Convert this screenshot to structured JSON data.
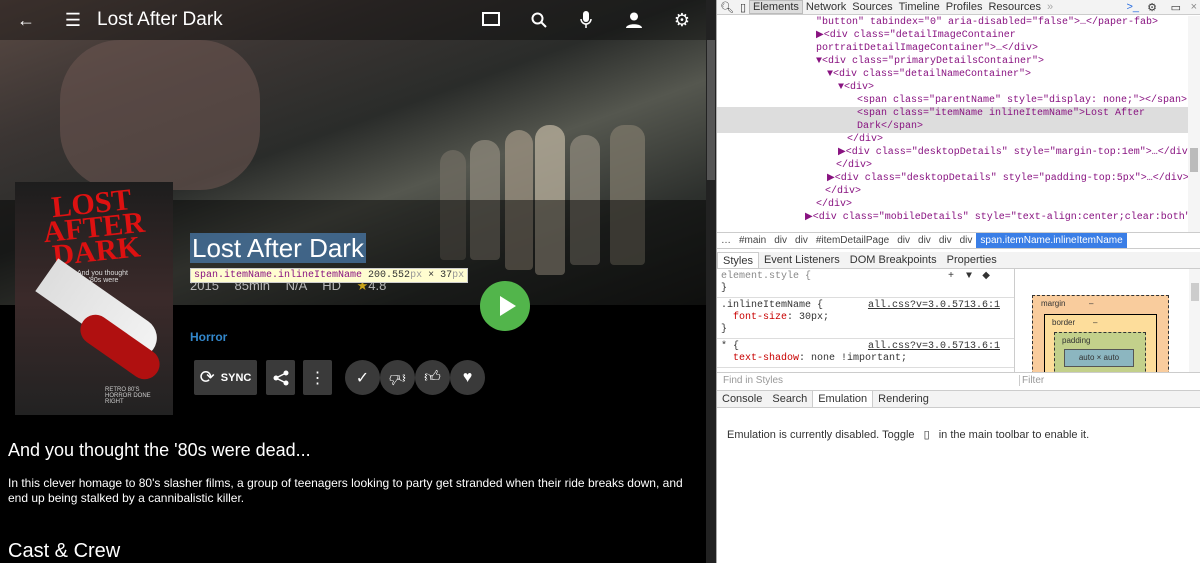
{
  "app": {
    "title": "Lost After Dark",
    "icons": [
      "back-arrow-icon",
      "menu-icon",
      "cast-icon",
      "search-icon",
      "microphone-icon",
      "user-icon",
      "gear-icon"
    ]
  },
  "item": {
    "title": "Lost After Dark",
    "meta": [
      "2015",
      "85min",
      "N/A",
      "HD",
      "4.8"
    ],
    "genre": "Horror",
    "tagline": "And you thought the '80s were dead...",
    "description": "In this clever homage to 80's slasher films, a group of teenagers looking to party get stranded when their ride breaks down, and end up being stalked by a cannibalistic killer.",
    "cast_heading": "Cast & Crew",
    "sync_label": "SYNC"
  },
  "poster": {
    "title_line1": "LOST",
    "title_line2": "AFTER",
    "title_line3": "DARK",
    "subtitle": "And you thought the '80s were dead...",
    "tagline": "RETRO 80'S HORROR DONE RIGHT"
  },
  "tooltip": {
    "selector": "span.itemName.inlineItemName",
    "width": "200.552",
    "height": "37",
    "unit": "px",
    "times": "×"
  },
  "devtools": {
    "tabs": [
      "Elements",
      "Network",
      "Sources",
      "Timeline",
      "Profiles",
      "Resources",
      "»"
    ],
    "dom": [
      "\"button\" tabindex=\"0\" aria-disabled=\"false\">…</paper-fab>",
      "▶<div class=\"detailImageContainer",
      "portraitDetailImageContainer\">…</div>",
      "▼<div class=\"primaryDetailsContainer\">",
      "▼<div class=\"detailNameContainer\">",
      "▼<div>",
      "<span class=\"parentName\" style=\"display: none;\"></span>",
      "<span class=\"itemName inlineItemName\">Lost After",
      "Dark</span>",
      "</div>",
      "▶<div class=\"desktopDetails\" style=\"margin-top:1em\">…</div>",
      "</div>",
      "▶<div class=\"desktopDetails\" style=\"padding-top:5px\">…</div>",
      "</div>",
      "</div>",
      "▶<div class=\"mobileDetails\" style=\"text-align:center;clear:both\">"
    ],
    "breadcrumbs": [
      "…",
      "#main",
      "div",
      "div",
      "#itemDetailPage",
      "div",
      "div",
      "div",
      "div",
      "span.itemName.inlineItemName"
    ],
    "subtabs": [
      "Styles",
      "Event Listeners",
      "DOM Breakpoints",
      "Properties"
    ],
    "styles": {
      "r1_sel": "element.style {",
      "r1_end": "}",
      "r2_sel": ".inlineItemName {",
      "r2_prop": "font-size",
      "r2_val": "30px;",
      "r2_end": "}",
      "r2_src": "all.css?v=3.0.5713.6:1",
      "r3_sel": "* {",
      "r3_prop": "text-shadow",
      "r3_val": "none !important;",
      "r3_src": "all.css?v=3.0.5713.6:1",
      "plus": "+"
    },
    "boxmodel": {
      "margin": "margin",
      "border": "border",
      "padding": "padding",
      "content": "auto × auto",
      "dash": "–"
    },
    "find_placeholder": "Find in Styles",
    "filter_placeholder": "Filter",
    "drawer_tabs": [
      "Console",
      "Search",
      "Emulation",
      "Rendering"
    ],
    "emulation_text_1": "Emulation is currently disabled. Toggle",
    "emulation_text_2": "in the main toolbar to enable it."
  }
}
